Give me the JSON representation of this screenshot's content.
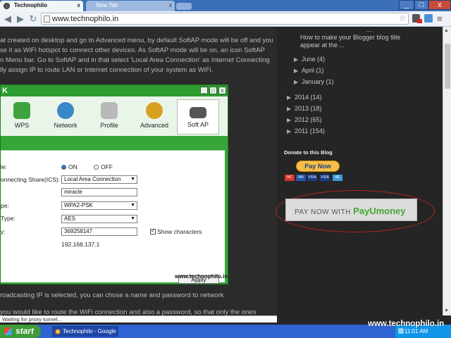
{
  "browser": {
    "tabs": [
      {
        "label": "Technophilo",
        "close": "x"
      },
      {
        "label": "New Tab",
        "close": "x"
      }
    ],
    "url": "www.technophilo.in",
    "window_buttons": {
      "min": "_",
      "max": "□",
      "close": "x"
    },
    "status": "Waiting for proxy tunnel..."
  },
  "article": {
    "para1": [
      "at created on desktop and go to Advanced menu, by default SoftAP mode will be off and you",
      "se it as WiFi hotspot to connect other devices. As SoftAP mode will be on, an icon SoftAP",
      "n Menu bar. Go to SoftAP and in that select 'Local Area Connection' as Internet Connecting",
      "lly assign IP to route LAN or Internet connection of your system as WiFi."
    ],
    "para2": "roadcasting IP is selected, you can chose a name and password to network",
    "para3": "you would like to route the WiFi connection and also a password, so that only the ones",
    "dialog": {
      "title": "K",
      "tools": [
        {
          "label": "WPS",
          "color": "#3ea33e"
        },
        {
          "label": "Network",
          "color": "#3a87c9"
        },
        {
          "label": "Profile",
          "color": "#9a9a9a"
        },
        {
          "label": "Advanced",
          "color": "#d9a020"
        },
        {
          "label": "Soft AP",
          "color": "#555555"
        }
      ],
      "rows": {
        "mode_label": "le:",
        "on": "ON",
        "off": "OFF",
        "ics_label": "onnecting Share(ICS):",
        "ics_value": "Local Area Connection",
        "ssid": "miracle",
        "sec_label": "pe:",
        "security": "WPA2-PSK",
        "enc_label": "Type:",
        "encryption": "AES",
        "key_label": "y:",
        "key": "369258147",
        "show_chars": "Show characters",
        "ip": "192.168.137.1",
        "apply": "Apply"
      },
      "watermark": "www.technophilo.in"
    }
  },
  "sidebar": {
    "top_link_partial": "....",
    "post_link_1": "How to make your Blogger blog title",
    "post_link_2": "appear at the ...",
    "months": [
      {
        "label": "June",
        "count": "(4)"
      },
      {
        "label": "April",
        "count": "(1)"
      },
      {
        "label": "January",
        "count": "(1)"
      }
    ],
    "years": [
      {
        "label": "2014",
        "count": "(14)"
      },
      {
        "label": "2013",
        "count": "(18)"
      },
      {
        "label": "2012",
        "count": "(65)"
      },
      {
        "label": "2011",
        "count": "(154)"
      }
    ],
    "donate_title": "Donate to this Blog",
    "paynow": "Pay Now",
    "cards": [
      "MC",
      "MA",
      "VISA",
      "VISA",
      "AE"
    ],
    "payu_prefix": "PAY NOW WITH",
    "payu_brand": "PayUmoney"
  },
  "taskbar": {
    "start": "start",
    "item": "Technophilo - Google ...",
    "clock": "11:01 AM"
  },
  "watermark_bottom": "www.technophilo.in"
}
